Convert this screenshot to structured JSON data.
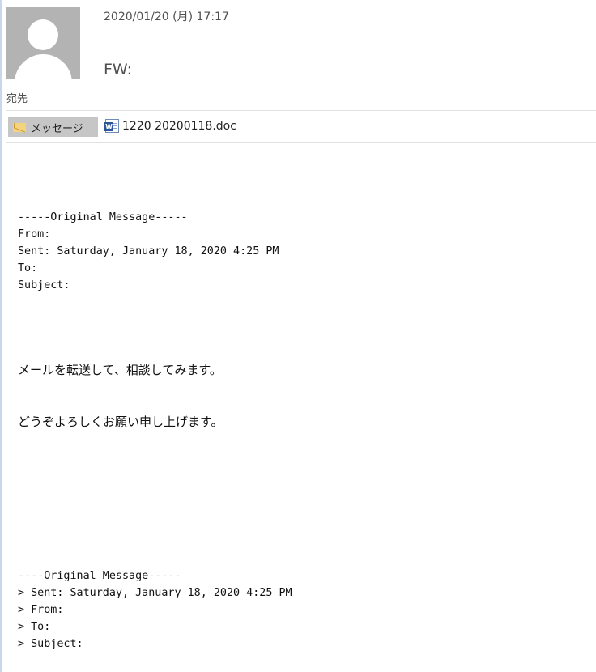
{
  "header": {
    "date": "2020/01/20 (月) 17:17",
    "subject": "FW:",
    "to_label": "宛先"
  },
  "tabs": {
    "message_label": "メッセージ",
    "attachment_name": "1220 20200118.doc"
  },
  "body": {
    "fwd1_header": "-----Original Message-----",
    "fwd1_from": "From:",
    "fwd1_sent": "Sent: Saturday, January 18, 2020 4:25 PM",
    "fwd1_to": "To:",
    "fwd1_subject": "Subject:",
    "line1": "メールを転送して、相談してみます。",
    "line2": "どうぞよろしくお願い申し上げます。",
    "fwd2_header": "----Original Message-----",
    "fwd2_sent": "> Sent: Saturday, January 18, 2020 4:25 PM",
    "fwd2_from": "> From:",
    "fwd2_to": "> To:",
    "fwd2_subject": "> Subject:"
  },
  "colors": {
    "avatar_bg": "#b3b3b3",
    "tab_bg": "#c6c6c6",
    "word_blue": "#2b579a"
  },
  "icons": [
    "person-avatar-icon",
    "envelope-icon",
    "word-document-icon"
  ]
}
